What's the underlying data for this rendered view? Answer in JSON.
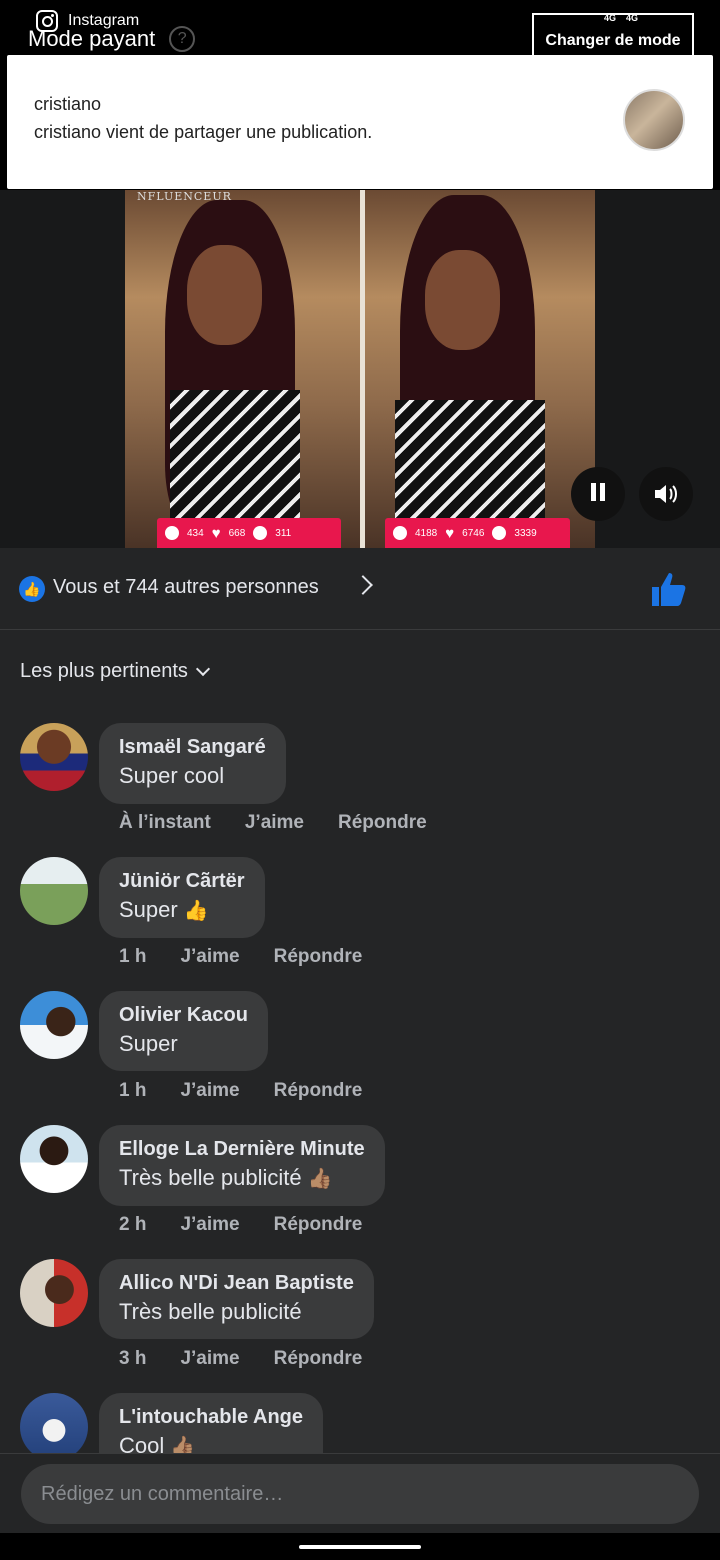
{
  "status_bar": {
    "app": "Instagram",
    "signal_left": "4G",
    "signal_right": "4G"
  },
  "header": {
    "mode_title": "Mode payant",
    "help_glyph": "?",
    "mode_button": "Changer de mode"
  },
  "notification": {
    "title": "cristiano",
    "text": "cristiano vient de partager une publication."
  },
  "video": {
    "watermark": "NFLUENCEUR",
    "left_stats": [
      "434",
      "668",
      "311"
    ],
    "right_stats": [
      "4188",
      "6746",
      "3339"
    ]
  },
  "likes": {
    "text": "Vous et 744 autres personnes"
  },
  "sort": {
    "label": "Les plus pertinents"
  },
  "comments": [
    {
      "name": "Ismaël Sangaré",
      "text": "Super cool",
      "emoji": "",
      "time": "À l’instant",
      "like": "J’aime",
      "reply": "Répondre"
    },
    {
      "name": "Jüniör Cãrtër",
      "text": "Super",
      "emoji": "👍",
      "time": "1 h",
      "like": "J’aime",
      "reply": "Répondre"
    },
    {
      "name": "Olivier Kacou",
      "text": "Super",
      "emoji": "",
      "time": "1 h",
      "like": "J’aime",
      "reply": "Répondre"
    },
    {
      "name": "Elloge La Dernière Minute",
      "text": "Très belle publicité",
      "emoji": "👍🏽",
      "time": "2 h",
      "like": "J’aime",
      "reply": "Répondre"
    },
    {
      "name": "Allico N'Di Jean Baptiste",
      "text": "Très belle publicité",
      "emoji": "",
      "time": "3 h",
      "like": "J’aime",
      "reply": "Répondre"
    },
    {
      "name": "L'intouchable Ange",
      "text": "Cool",
      "emoji": "👍🏽",
      "time": "",
      "like": "",
      "reply": ""
    }
  ],
  "comment_input": {
    "placeholder": "Rédigez un commentaire…"
  },
  "colors": {
    "accent": "#1b74e4",
    "background": "#242526",
    "bubble": "#3a3b3c"
  }
}
